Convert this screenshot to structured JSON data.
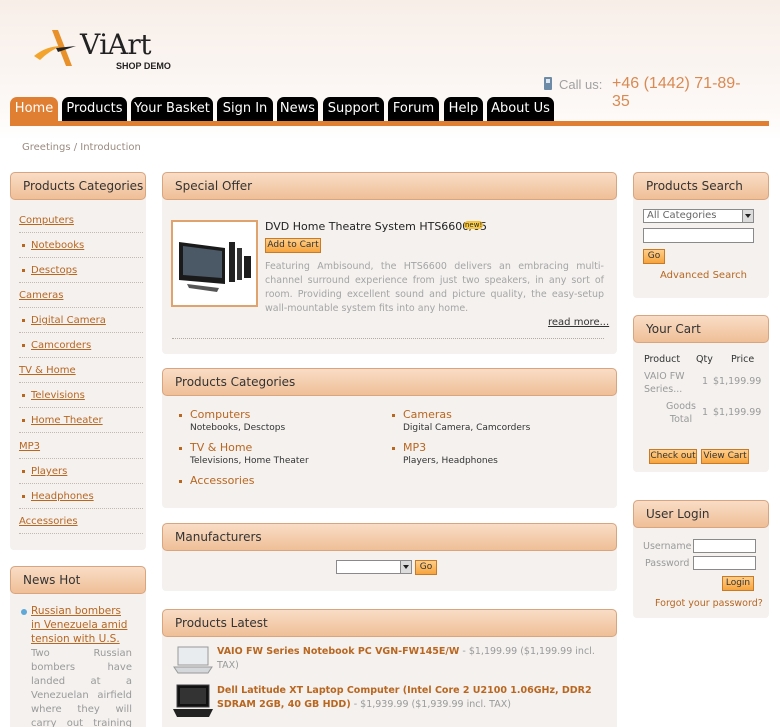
{
  "header": {
    "logo_text": "ViArt",
    "logo_sub": "SHOP DEMO",
    "call_label": "Call us:",
    "phone": "+46 (1442) 71-89-35"
  },
  "nav": {
    "tabs": [
      "Home",
      "Products",
      "Your Basket",
      "Sign In",
      "News",
      "Support",
      "Forum",
      "Help",
      "About Us"
    ],
    "active": "Home"
  },
  "breadcrumb": "Greetings / Introduction",
  "left_categories": {
    "title": "Products Categories",
    "items": [
      {
        "label": "Computers",
        "level": 0
      },
      {
        "label": "Notebooks",
        "level": 1
      },
      {
        "label": "Desctops",
        "level": 1
      },
      {
        "label": "Cameras",
        "level": 0
      },
      {
        "label": "Digital Camera",
        "level": 1
      },
      {
        "label": "Camcorders",
        "level": 1
      },
      {
        "label": "TV & Home",
        "level": 0
      },
      {
        "label": "Televisions",
        "level": 1
      },
      {
        "label": "Home Theater",
        "level": 1
      },
      {
        "label": "MP3",
        "level": 0
      },
      {
        "label": "Players",
        "level": 1
      },
      {
        "label": "Headphones",
        "level": 1
      },
      {
        "label": "Accessories",
        "level": 0
      }
    ]
  },
  "news_hot": {
    "title": "News Hot",
    "headline": "Russian bombers in Venezuela amid tension with U.S.",
    "body": "Two Russian bombers have landed at a Venezuelan airfield where they will carry out training flights for several days, the"
  },
  "special_offer": {
    "title": "Special Offer",
    "product_name": "DVD Home Theatre System HTS6600/05",
    "new_badge": "new!",
    "add_to_cart": "Add to Cart",
    "description": "Featuring Ambisound, the HTS6600 delivers an embracing multi-channel surround experience from just two speakers, in any sort of room. Providing excellent sound and picture quality, the easy-setup wall-mountable system fits into any home.",
    "read_more": "read more..."
  },
  "center_categories": {
    "title": "Products Categories",
    "groups": [
      {
        "name": "Computers",
        "subs": [
          "Notebooks",
          "Desctops"
        ]
      },
      {
        "name": "Cameras",
        "subs": [
          "Digital Camera",
          "Camcorders"
        ]
      },
      {
        "name": "TV & Home",
        "subs": [
          "Televisions",
          "Home Theater"
        ]
      },
      {
        "name": "MP3",
        "subs": [
          "Players",
          "Headphones"
        ]
      },
      {
        "name": "Accessories",
        "subs": []
      }
    ]
  },
  "manufacturers": {
    "title": "Manufacturers",
    "select_value": "",
    "go": "Go"
  },
  "products_latest": {
    "title": "Products Latest",
    "items": [
      {
        "name": "VAIO FW Series Notebook PC VGN-FW145E/W",
        "price": "- $1,199.99",
        "tax": "($1,199.99 incl. TAX)"
      },
      {
        "name": "Dell Latitude XT Laptop Computer (Intel Core 2 U2100 1.06GHz, DDR2 SDRAM 2GB, 40 GB HDD)",
        "price": "- $1,939.99",
        "tax": "($1,939.99 incl. TAX)"
      }
    ]
  },
  "search": {
    "title": "Products Search",
    "category_value": "All Categories",
    "query": "",
    "go": "Go",
    "advanced": "Advanced Search"
  },
  "cart": {
    "title": "Your Cart",
    "headers": [
      "Product",
      "Qty",
      "Price"
    ],
    "rows": [
      {
        "product": "VAIO FW Series...",
        "qty": "1",
        "price": "$1,199.99"
      }
    ],
    "total_label": "Goods Total",
    "total_qty": "1",
    "total_price": "$1,199.99",
    "checkout": "Check out",
    "view_cart": "View Cart"
  },
  "login": {
    "title": "User Login",
    "username_label": "Username",
    "password_label": "Password",
    "username": "",
    "password": "",
    "login_btn": "Login",
    "forgot": "Forgot your password?"
  },
  "colors": {
    "accent": "#e07e31",
    "link": "#b9661f",
    "header_bg": "#efbf97"
  }
}
